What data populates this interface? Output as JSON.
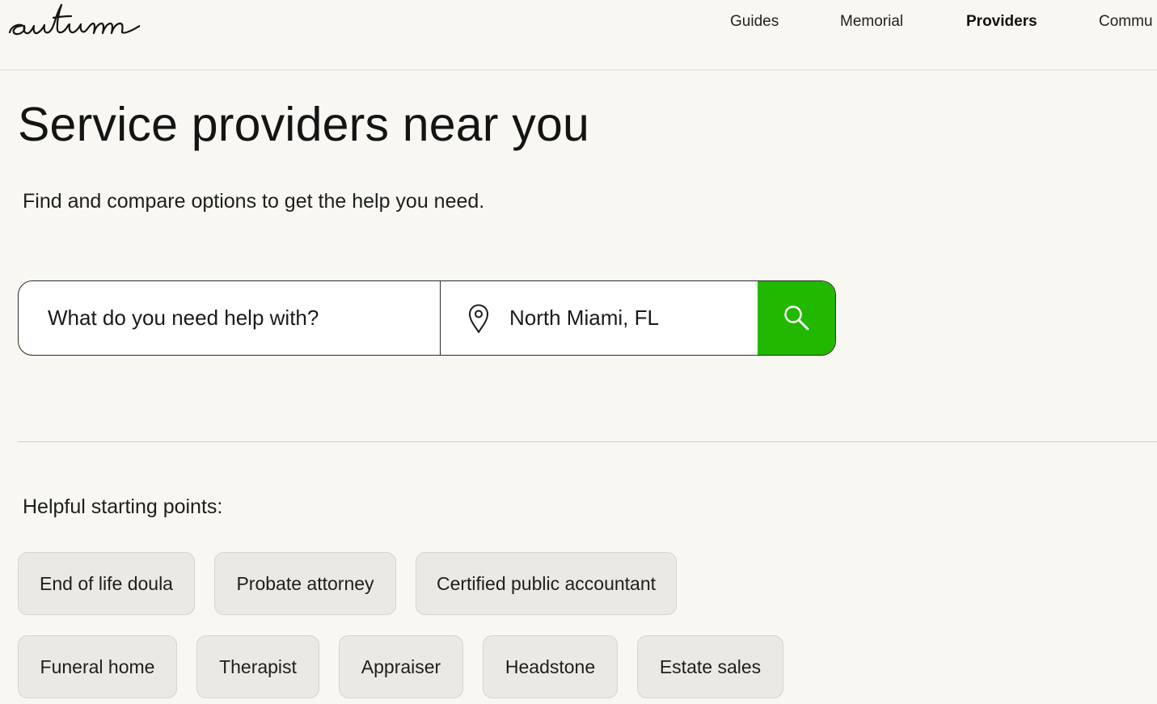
{
  "header": {
    "logo_text": "autumn",
    "nav": [
      {
        "label": "Guides",
        "active": false
      },
      {
        "label": "Memorial",
        "active": false
      },
      {
        "label": "Providers",
        "active": true
      },
      {
        "label": "Commu",
        "active": false
      }
    ]
  },
  "main": {
    "title": "Service providers near you",
    "subtitle": "Find and compare options to get the help you need."
  },
  "search": {
    "service_placeholder": "What do you need help with?",
    "location_value": "North Miami, FL",
    "location_icon": "map-pin-icon",
    "submit_icon": "search-icon",
    "accent_color": "#22b800"
  },
  "starting_points": {
    "heading": "Helpful starting points:",
    "chips": [
      "End of life doula",
      "Probate attorney",
      "Certified public accountant",
      "Funeral home",
      "Therapist",
      "Appraiser",
      "Headstone",
      "Estate sales"
    ]
  }
}
